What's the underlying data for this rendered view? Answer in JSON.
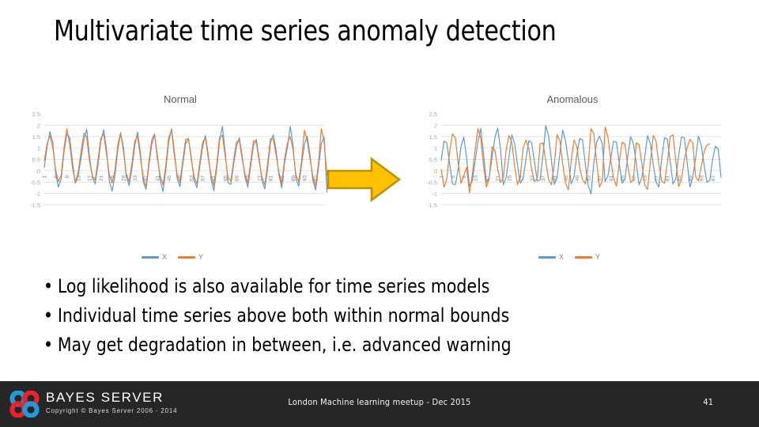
{
  "slide": {
    "title": "Multivariate time series anomaly detection",
    "bullets": [
      "Log likelihood is also available for time series models",
      "Individual time series above both within normal bounds",
      "May get degradation in between, i.e. advanced warning"
    ],
    "bullet_marker": "•"
  },
  "arrow": {
    "name": "right-arrow",
    "fill": "#FFC000",
    "stroke": "#BF9000"
  },
  "footer": {
    "background": "#262626",
    "brand_name": "BAYES SERVER",
    "copyright": "Copyright © Bayes Server 2006 - 2014",
    "center_text": "London Machine learning meetup - Dec 2015",
    "page_number": "41",
    "logo_colors": {
      "blue": "#1F9BD8",
      "red": "#E8232A"
    }
  },
  "chart_data": [
    {
      "id": "normal",
      "type": "line",
      "title": "Normal",
      "xlabel": "",
      "ylabel": "",
      "ylim": [
        -1.5,
        2.5
      ],
      "yticks": [
        2.5,
        2,
        1.5,
        1,
        0.5,
        0,
        -0.5,
        -1,
        -1.5
      ],
      "ytick_labels": [
        "2.5",
        "2",
        "1.5",
        "1",
        "0.5",
        "0",
        "-0.5",
        "-1",
        "-1.5"
      ],
      "grid": true,
      "legend_position": "bottom",
      "xtick_labels": [
        "1",
        "5",
        "9",
        "13",
        "17",
        "21",
        "25",
        "29",
        "33",
        "37",
        "41",
        "45",
        "49",
        "53",
        "57",
        "61",
        "65",
        "69",
        "73",
        "77",
        "81",
        "85",
        "89",
        "93",
        "97"
      ],
      "x": [
        1,
        2,
        3,
        4,
        5,
        6,
        7,
        8,
        9,
        10,
        11,
        12,
        13,
        14,
        15,
        16,
        17,
        18,
        19,
        20,
        21,
        22,
        23,
        24,
        25,
        26,
        27,
        28,
        29,
        30,
        31,
        32,
        33,
        34,
        35,
        36,
        37,
        38,
        39,
        40,
        41,
        42,
        43,
        44,
        45,
        46,
        47,
        48,
        49,
        50,
        51,
        52,
        53,
        54,
        55,
        56,
        57,
        58,
        59,
        60,
        61,
        62,
        63,
        64,
        65,
        66,
        67,
        68,
        69,
        70,
        71,
        72,
        73,
        74,
        75,
        76,
        77,
        78,
        79,
        80,
        81,
        82,
        83,
        84,
        85,
        86,
        87,
        88,
        89,
        90,
        91,
        92,
        93,
        94,
        95,
        96,
        97,
        98,
        99,
        100
      ],
      "series": [
        {
          "name": "X",
          "color": "#5B9BD5",
          "values": [
            0.15,
            1.05,
            1.72,
            1.25,
            -0.12,
            -0.72,
            -0.35,
            0.85,
            1.62,
            1.45,
            0.35,
            -0.55,
            -0.22,
            0.55,
            1.35,
            1.83,
            0.62,
            -0.3,
            -0.58,
            0.25,
            1.28,
            1.8,
            0.95,
            -0.45,
            -0.9,
            -0.22,
            0.92,
            1.63,
            1.02,
            -0.25,
            -0.65,
            0.1,
            1.1,
            1.7,
            0.78,
            -0.48,
            -0.82,
            0.22,
            1.15,
            1.58,
            0.7,
            -0.4,
            -0.92,
            0.05,
            1.25,
            1.85,
            0.88,
            -0.35,
            -0.7,
            0.28,
            1.18,
            1.42,
            0.6,
            -0.42,
            -0.75,
            0.18,
            1.05,
            1.55,
            0.72,
            -0.38,
            -0.88,
            0.12,
            1.3,
            1.95,
            0.82,
            -0.52,
            -0.6,
            0.3,
            1.08,
            1.45,
            0.65,
            -0.3,
            -0.72,
            0.2,
            1.12,
            1.38,
            0.55,
            -0.45,
            -0.8,
            0.08,
            1.22,
            1.58,
            0.9,
            -0.2,
            -0.75,
            0.35,
            1.02,
            1.95,
            1.1,
            -0.35,
            -0.68,
            0.25,
            1.15,
            1.52,
            0.68,
            -0.42,
            -0.85,
            0.15,
            1.2,
            1.48,
            -0.95
          ]
        },
        {
          "name": "Y",
          "color": "#ED7D31",
          "values": [
            0.45,
            1.18,
            1.55,
            1.02,
            0.05,
            -0.48,
            -0.18,
            1.02,
            1.85,
            1.15,
            0.12,
            -0.52,
            -0.05,
            0.82,
            1.65,
            1.48,
            0.42,
            -0.22,
            -0.42,
            0.48,
            1.42,
            1.62,
            0.72,
            -0.18,
            -0.55,
            0.02,
            1.12,
            1.68,
            0.85,
            -0.12,
            -0.48,
            0.32,
            1.3,
            1.52,
            0.58,
            -0.28,
            -0.72,
            0.38,
            1.35,
            1.62,
            0.52,
            -0.22,
            -0.62,
            0.25,
            1.45,
            1.78,
            0.68,
            -0.18,
            -0.52,
            0.45,
            1.38,
            1.4,
            0.48,
            -0.25,
            -0.58,
            0.35,
            1.25,
            1.45,
            0.55,
            -0.2,
            -0.65,
            0.28,
            1.48,
            1.55,
            0.62,
            -0.3,
            -0.45,
            0.48,
            1.28,
            1.32,
            0.5,
            -0.15,
            -0.55,
            0.4,
            1.32,
            1.25,
            0.42,
            -0.28,
            -0.62,
            0.3,
            1.42,
            1.38,
            0.7,
            -0.08,
            -0.58,
            0.52,
            1.22,
            1.5,
            0.92,
            -0.18,
            -0.48,
            0.42,
            1.78,
            1.32,
            0.52,
            -0.25,
            -0.68,
            0.35,
            1.85,
            1.25,
            -0.22
          ]
        }
      ]
    },
    {
      "id": "anomalous",
      "type": "line",
      "title": "Anomalous",
      "xlabel": "",
      "ylabel": "",
      "ylim": [
        -1.5,
        2.5
      ],
      "yticks": [
        2.5,
        2,
        1.5,
        1,
        0.5,
        0,
        -0.5,
        -1,
        -1.5
      ],
      "ytick_labels": [
        "2.5",
        "2",
        "1.5",
        "1",
        "0.5",
        "0",
        "-0.5",
        "-1",
        "-1.5"
      ],
      "grid": true,
      "legend_position": "bottom",
      "xtick_labels": [
        "1",
        "5",
        "9",
        "13",
        "17",
        "21",
        "25",
        "29",
        "33",
        "37",
        "41",
        "45",
        "49",
        "53",
        "57",
        "61",
        "65",
        "69",
        "73",
        "77",
        "81",
        "85",
        "89",
        "93",
        "97"
      ],
      "x": [
        1,
        2,
        3,
        4,
        5,
        6,
        7,
        8,
        9,
        10,
        11,
        12,
        13,
        14,
        15,
        16,
        17,
        18,
        19,
        20,
        21,
        22,
        23,
        24,
        25,
        26,
        27,
        28,
        29,
        30,
        31,
        32,
        33,
        34,
        35,
        36,
        37,
        38,
        39,
        40,
        41,
        42,
        43,
        44,
        45,
        46,
        47,
        48,
        49,
        50,
        51,
        52,
        53,
        54,
        55,
        56,
        57,
        58,
        59,
        60,
        61,
        62,
        63,
        64,
        65,
        66,
        67,
        68,
        69,
        70,
        71,
        72,
        73,
        74,
        75,
        76,
        77,
        78,
        79,
        80,
        81,
        82,
        83,
        84,
        85,
        86,
        87,
        88,
        89,
        90,
        91,
        92,
        93,
        94,
        95,
        96,
        97,
        98,
        99,
        100
      ],
      "series": [
        {
          "name": "X",
          "color": "#5B9BD5",
          "values": [
            0.45,
            1.3,
            1.22,
            0.3,
            -0.58,
            -0.62,
            0.05,
            1.05,
            1.48,
            0.55,
            -0.68,
            -0.45,
            0.42,
            1.28,
            1.85,
            0.72,
            -0.52,
            -0.3,
            0.58,
            1.45,
            1.88,
            0.95,
            -0.62,
            -0.28,
            0.62,
            1.58,
            1.18,
            0.25,
            -0.55,
            -0.35,
            0.52,
            1.32,
            1.22,
            0.38,
            -0.45,
            -0.4,
            0.68,
            1.98,
            1.52,
            0.45,
            -0.6,
            -0.32,
            0.78,
            1.78,
            1.3,
            0.42,
            -0.58,
            -0.25,
            0.72,
            1.42,
            1.35,
            0.28,
            -0.65,
            -1.02,
            0.35,
            1.25,
            1.52,
            1.18,
            -0.48,
            -0.22,
            0.55,
            1.3,
            1.25,
            0.32,
            -0.55,
            -0.38,
            0.62,
            1.5,
            1.2,
            0.35,
            -0.62,
            -0.3,
            0.58,
            1.55,
            1.18,
            0.28,
            -0.48,
            -0.72,
            0.52,
            1.45,
            1.38,
            0.42,
            -0.58,
            -0.35,
            0.65,
            1.48,
            1.45,
            0.38,
            -0.72,
            -0.28,
            0.55,
            1.52,
            1.12,
            0.25,
            -0.5,
            -0.42,
            0.48,
            1.08,
            0.95,
            -0.3
          ]
        },
        {
          "name": "Y",
          "color": "#ED7D31",
          "values": [
            0.05,
            -0.72,
            -0.35,
            0.85,
            1.62,
            1.45,
            0.35,
            -0.55,
            -0.22,
            0.15,
            -0.98,
            -0.18,
            0.92,
            1.85,
            1.42,
            0.22,
            -0.72,
            -0.35,
            1.05,
            0.9,
            0.08,
            -0.52,
            -0.3,
            0.95,
            1.55,
            1.25,
            0.18,
            -0.6,
            -0.25,
            1.02,
            1.35,
            0.95,
            0.05,
            -0.48,
            -0.35,
            1.18,
            1.22,
            0.42,
            -0.4,
            -0.62,
            0.28,
            1.58,
            1.32,
            0.3,
            -0.55,
            -0.85,
            0.45,
            1.35,
            1.05,
            0.12,
            -0.38,
            -0.58,
            0.22,
            1.85,
            1.62,
            0.35,
            -0.72,
            -0.45,
            1.92,
            1.48,
            0.45,
            -0.35,
            -0.68,
            0.38,
            1.25,
            1.18,
            0.22,
            -0.52,
            -0.4,
            1.22,
            1.15,
            0.3,
            -0.62,
            -0.82,
            0.4,
            1.55,
            1.3,
            0.28,
            -0.45,
            -0.55,
            0.35,
            1.5,
            1.58,
            0.42,
            -0.7,
            -0.38,
            0.48,
            1.02,
            1.38,
            1.22,
            -0.25,
            -0.45,
            0.18,
            0.85,
            1.12,
            1.18
          ]
        }
      ]
    }
  ]
}
